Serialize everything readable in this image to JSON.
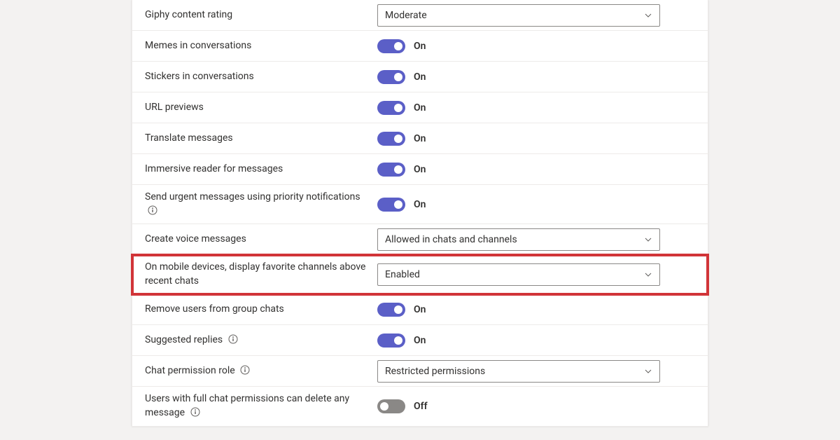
{
  "labels": {
    "on": "On",
    "off": "Off"
  },
  "rows": {
    "giphy": {
      "label": "Giphy content rating",
      "value": "Moderate"
    },
    "memes": {
      "label": "Memes in conversations"
    },
    "stickers": {
      "label": "Stickers in conversations"
    },
    "url": {
      "label": "URL previews"
    },
    "translate": {
      "label": "Translate messages"
    },
    "immersive": {
      "label": "Immersive reader for messages"
    },
    "urgent": {
      "label": "Send urgent messages using priority notifications"
    },
    "voice": {
      "label": "Create voice messages",
      "value": "Allowed in chats and channels"
    },
    "mobile": {
      "label": "On mobile devices, display favorite channels above recent chats",
      "value": "Enabled"
    },
    "remove": {
      "label": "Remove users from group chats"
    },
    "suggested": {
      "label": "Suggested replies"
    },
    "chatperm": {
      "label": "Chat permission role",
      "value": "Restricted permissions"
    },
    "delete": {
      "label": "Users with full chat permissions can delete any message"
    }
  }
}
